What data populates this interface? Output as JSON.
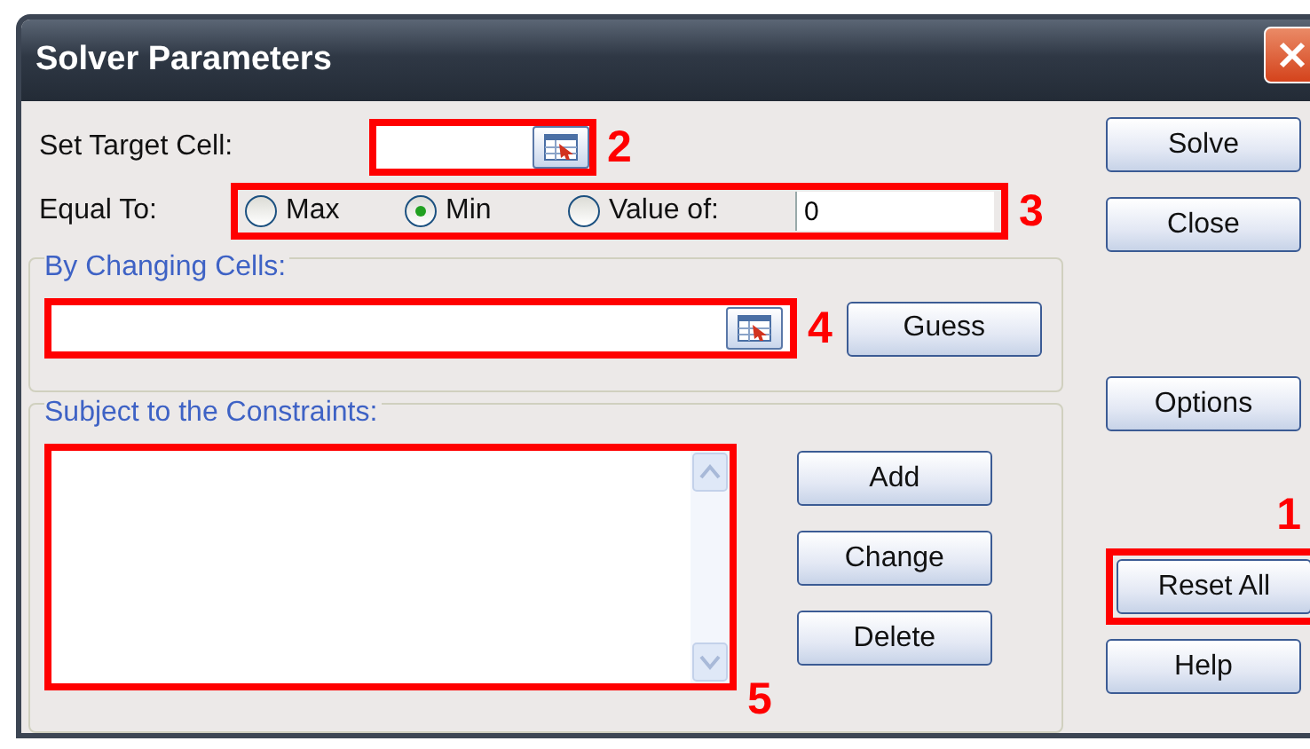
{
  "window": {
    "title": "Solver Parameters"
  },
  "target_cell": {
    "label": "Set Target Cell:",
    "annotation": "2"
  },
  "equal_to": {
    "label": "Equal To:",
    "annotation": "3",
    "value": "0",
    "options": [
      {
        "label": "Max",
        "selected": false
      },
      {
        "label": "Min",
        "selected": true
      },
      {
        "label": "Value of:",
        "selected": false
      }
    ]
  },
  "changing_cells": {
    "title": "By Changing Cells:",
    "annotation": "4",
    "button": "Guess"
  },
  "constraints": {
    "title": "Subject to the Constraints:",
    "annotation": "5",
    "buttons": [
      "Add",
      "Change",
      "Delete"
    ]
  },
  "side_buttons": [
    {
      "label": "Solve"
    },
    {
      "label": "Close"
    },
    {
      "label": "Options"
    },
    {
      "label": "Reset All",
      "annotation": "1"
    },
    {
      "label": "Help"
    }
  ]
}
